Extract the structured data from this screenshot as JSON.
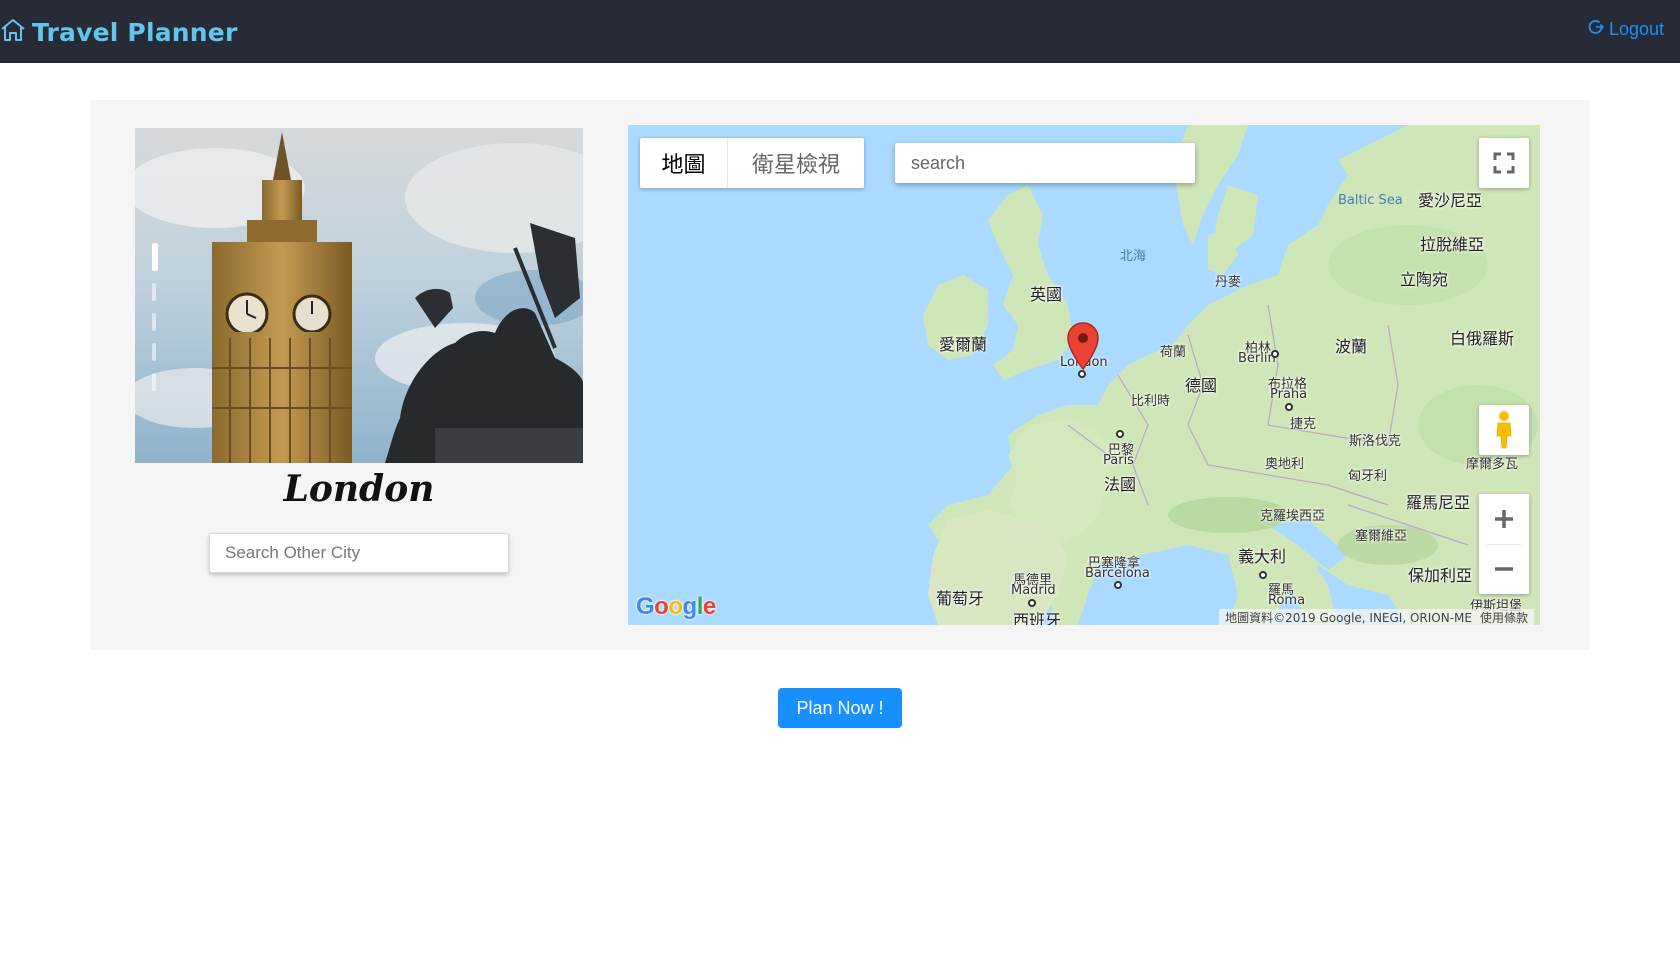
{
  "header": {
    "brand_icon": "home-icon",
    "title": "Travel Planner",
    "logout_icon": "logout-icon",
    "logout_label": "Logout",
    "background": "#262b35",
    "title_color": "#62c4ef",
    "link_color": "#1890ff"
  },
  "city_panel": {
    "photo_icon": "big-ben-photo",
    "city_name": "London",
    "search_placeholder": "Search Other City"
  },
  "map": {
    "type_tabs": [
      "地圖",
      "衛星檢視"
    ],
    "search_placeholder": "search",
    "fullscreen_icon": "fullscreen-icon",
    "pegman_icon": "pegman-icon",
    "zoom_in_icon": "plus-icon",
    "zoom_out_icon": "minus-icon",
    "marker_icon": "map-pin-icon",
    "logo": "Google",
    "attribution": "地圖資料©2019 Google, INEGI, ORION-ME",
    "terms": "使用條款",
    "labels": {
      "baltic_sea": "Baltic Sea",
      "north_sea": "北海",
      "estonia": "愛沙尼亞",
      "latvia": "拉脫維亞",
      "lithuania": "立陶宛",
      "belarus": "白俄羅斯",
      "denmark": "丹麥",
      "uk": "英國",
      "ireland": "愛爾蘭",
      "netherlands": "荷蘭",
      "berlin_zh": "柏林",
      "berlin": "Berlin",
      "poland": "波蘭",
      "london": "London",
      "germany": "德國",
      "prague_zh": "布拉格",
      "prague": "Praha",
      "belgium": "比利時",
      "czech": "捷克",
      "slovakia": "斯洛伐克",
      "paris_zh": "巴黎",
      "paris": "Paris",
      "austria": "奧地利",
      "hungary": "匈牙利",
      "moldova": "摩爾多瓦",
      "france": "法國",
      "romania": "羅馬尼亞",
      "croatia": "克羅埃西亞",
      "serbia": "塞爾維亞",
      "barcelona_zh": "巴塞隆拿",
      "barcelona": "Barcelona",
      "italy": "義大利",
      "madrid_zh": "馬德里",
      "madrid": "Madrid",
      "portugal": "葡萄牙",
      "rome_zh": "羅馬",
      "rome": "Roma",
      "bulgaria": "保加利亞",
      "spain": "西班牙",
      "istanbul_zh": "伊斯坦堡"
    },
    "colors": {
      "water": "#aadaff",
      "land": "#cfe6b8",
      "marker": "#ea4335"
    }
  },
  "actions": {
    "plan_label": "Plan Now !",
    "plan_color": "#1890ff"
  }
}
